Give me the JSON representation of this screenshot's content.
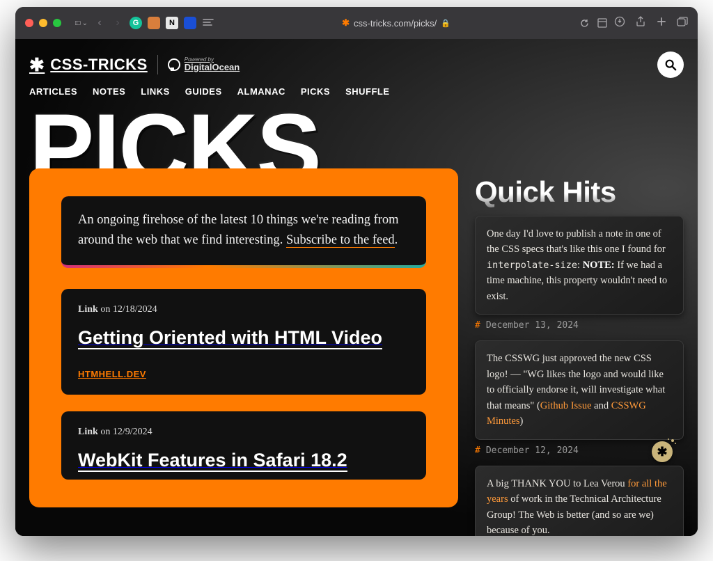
{
  "browser": {
    "url_display": "css-tricks.com/picks/"
  },
  "site": {
    "logo_text": "CSS-TRICKS",
    "powered_label": "Powered by",
    "powered_name": "DigitalOcean"
  },
  "nav": {
    "items": [
      "ARTICLES",
      "NOTES",
      "LINKS",
      "GUIDES",
      "ALMANAC",
      "PICKS",
      "SHUFFLE"
    ]
  },
  "hero": {
    "title": "PICKS"
  },
  "intro": {
    "text_before": "An ongoing firehose of the latest 10 things we're reading from around the web that we find interesting. ",
    "link_text": "Subscribe to the feed",
    "text_after": "."
  },
  "picks": [
    {
      "type_label": "Link",
      "date_prefix": " on ",
      "date": "12/18/2024",
      "title": "Getting Oriented with HTML Video",
      "domain": "HTMHELL.DEV"
    },
    {
      "type_label": "Link",
      "date_prefix": " on ",
      "date": "12/9/2024",
      "title": "WebKit Features in Safari 18.2",
      "domain": ""
    }
  ],
  "quickhits": {
    "title": "Quick Hits",
    "items": [
      {
        "body_html": "One day I'd love to publish a note in one of the CSS specs that's like this one I found for <code>interpolate-size</code>: <strong>NOTE:</strong> If we had a time machine, this property wouldn't need to exist.",
        "date": "December 13, 2024"
      },
      {
        "body_html": "The CSSWG just approved the new CSS logo! — \"WG likes the logo and would like to officially endorse it, will investigate what that means\" (<a href='#'>Github Issue</a> and <a href='#'>CSSWG Minutes</a>)",
        "date": "December 12, 2024"
      },
      {
        "body_html": "A big THANK YOU to Lea Verou <a href='#'>for all the years</a> of work in the Technical Architecture Group! The Web is better (and so are we) because of you.",
        "date": ""
      }
    ]
  }
}
